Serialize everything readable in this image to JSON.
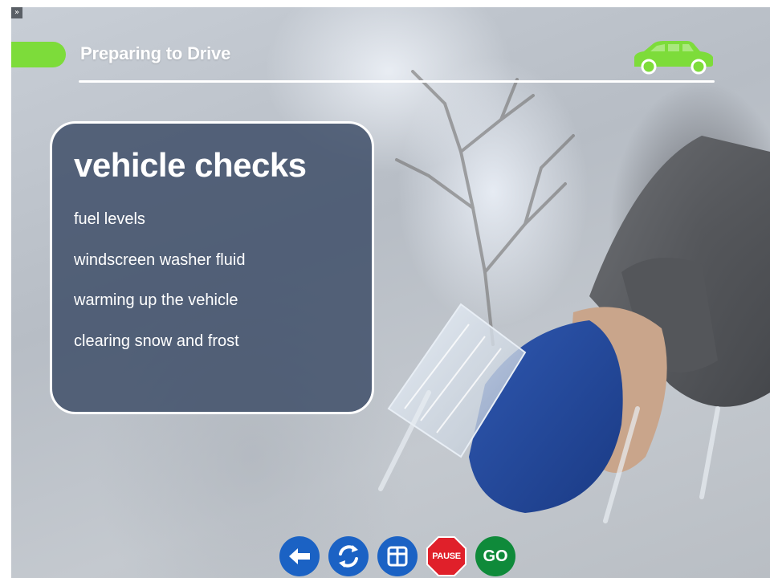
{
  "header": {
    "title": "Preparing to Drive"
  },
  "panel": {
    "title": "vehicle checks",
    "items": [
      "fuel levels",
      "windscreen washer fluid",
      "warming up the vehicle",
      "clearing snow and frost"
    ]
  },
  "nav": {
    "expand_glyph": "»",
    "pause_label": "PAUSE",
    "go_label": "GO"
  },
  "icons": {
    "car": "car-icon",
    "back": "arrow-left-icon",
    "replay": "replay-icon",
    "menu": "grid-menu-icon"
  },
  "colors": {
    "accent_green": "#7ddc3a",
    "nav_blue": "#1b62c4",
    "pause_red": "#e0202a",
    "go_green": "#0f8a3a",
    "panel_bg": "#3a4a65"
  }
}
